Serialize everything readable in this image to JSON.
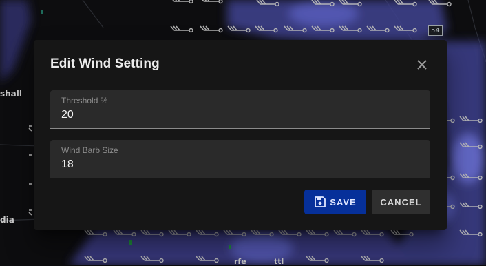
{
  "map": {
    "labels": {
      "marshall": "shall",
      "lower_left": "dia",
      "bottom_fragment": "rfe",
      "bottom_fragment2": "ttl"
    },
    "route_shield": "54"
  },
  "dialog": {
    "title": "Edit Wind Setting",
    "close_icon": "close-icon",
    "fields": {
      "threshold": {
        "label": "Threshold %",
        "value": "20"
      },
      "barb_size": {
        "label": "Wind Barb Size",
        "value": "18"
      }
    },
    "actions": {
      "save_label": "SAVE",
      "save_icon": "floppy-disk-icon",
      "cancel_label": "CANCEL"
    }
  },
  "colors": {
    "dialog_bg": "#161616",
    "field_bg": "#2a2a2a",
    "save_button": "#06309a",
    "cancel_button": "#2f2f2f",
    "radar_precip": "#5a60c8",
    "wind_barb": "#b9b9b9"
  }
}
